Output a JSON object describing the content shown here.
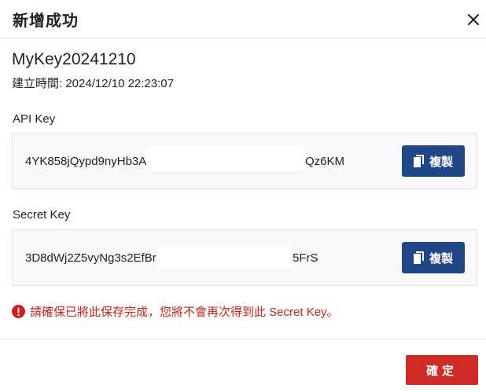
{
  "dialog": {
    "title": "新增成功",
    "close_icon": "close-icon"
  },
  "key_info": {
    "name": "MyKey20241210",
    "created_label": "建立時間:",
    "created_value": "2024/12/10 22:23:07"
  },
  "api_key": {
    "label": "API Key",
    "visible_start": "4YK858jQypd9nyHb3A",
    "visible_end": "Qz6KM",
    "copy_label": "複製",
    "copy_icon": "copy-icon"
  },
  "secret_key": {
    "label": "Secret Key",
    "visible_start": "3D8dWj2Z5vyNg3s2EfBr",
    "visible_end": "5FrS",
    "copy_label": "複製",
    "copy_icon": "copy-icon"
  },
  "warning": {
    "icon": "warning-circle-icon",
    "text": "請確保已將此保存完成，您將不會再次得到此 Secret Key。"
  },
  "footer": {
    "confirm_label": "確定"
  },
  "colors": {
    "primary_blue": "#1f4788",
    "danger_red": "#cf2b26",
    "warning_text": "#c8201c",
    "box_bg": "#f7f9fb",
    "box_border": "#dfe3e8"
  }
}
